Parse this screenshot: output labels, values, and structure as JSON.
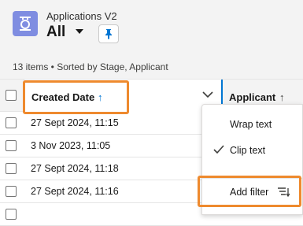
{
  "header": {
    "app_icon": "list-view-icon",
    "object_title": "Applications V2",
    "view_name": "All",
    "view_caret_icon": "chevron-down-icon",
    "pin_icon": "pin-icon",
    "summary": "13 items • Sorted by Stage, Applicant"
  },
  "table": {
    "columns": {
      "created_date": {
        "label": "Created Date",
        "sort_icon": "↑",
        "menu_icon": "chevron-down-icon"
      },
      "applicant": {
        "label": "Applicant",
        "sort_icon": "↑"
      }
    },
    "rows": [
      {
        "created_date": "27 Sept 2024, 11:15"
      },
      {
        "created_date": "3 Nov 2023, 11:05"
      },
      {
        "created_date": "27 Sept 2024, 11:18"
      },
      {
        "created_date": "27 Sept 2024, 11:16"
      }
    ]
  },
  "column_menu": {
    "wrap_text": "Wrap text",
    "clip_text": "Clip text",
    "clip_text_selected": true,
    "add_filter": "Add filter",
    "add_filter_icon": "filter-list-icon"
  },
  "colors": {
    "accent": "#0176d3",
    "highlight": "#ee8a2e",
    "app_icon_bg": "#7f8de1"
  }
}
